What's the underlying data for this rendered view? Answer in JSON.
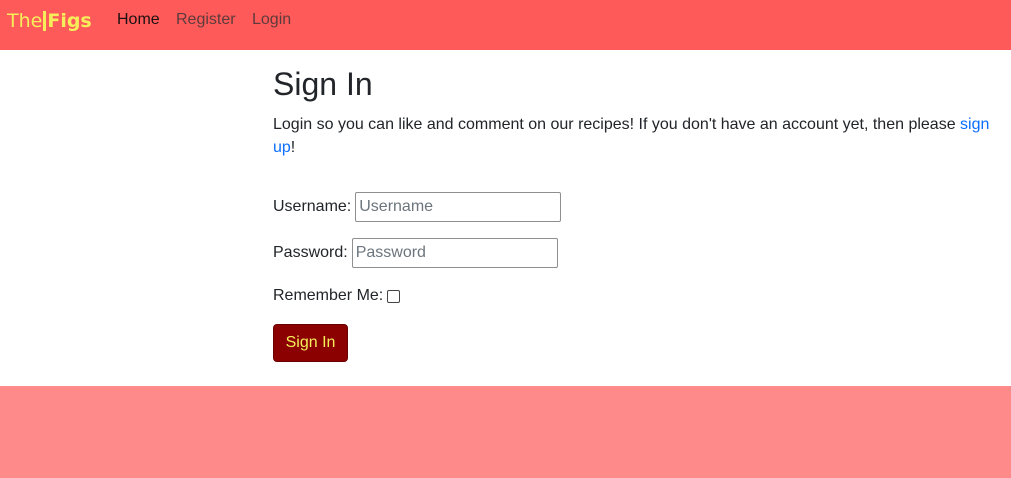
{
  "navbar": {
    "brand_prefix": "The",
    "brand_name": "Figs",
    "links": [
      {
        "label": "Home"
      },
      {
        "label": "Register"
      },
      {
        "label": "Login"
      }
    ]
  },
  "main": {
    "title": "Sign In",
    "intro_text": "Login so you can like and comment on our recipes! If you don't have an account yet, then please ",
    "intro_link": "sign up",
    "intro_end": "!"
  },
  "form": {
    "username_label": "Username:",
    "username_placeholder": "Username",
    "username_value": "",
    "password_label": "Password:",
    "password_placeholder": "Password",
    "password_value": "",
    "remember_label": "Remember Me:",
    "remember_checked": false,
    "submit_label": "Sign In"
  },
  "colors": {
    "navbar_bg": "#ff5a5a",
    "brand": "#f5ee5a",
    "button_bg": "#8b0000",
    "button_text": "#f5ee5a",
    "footer_bg": "#ff8a8a",
    "link": "#0d6efd"
  }
}
